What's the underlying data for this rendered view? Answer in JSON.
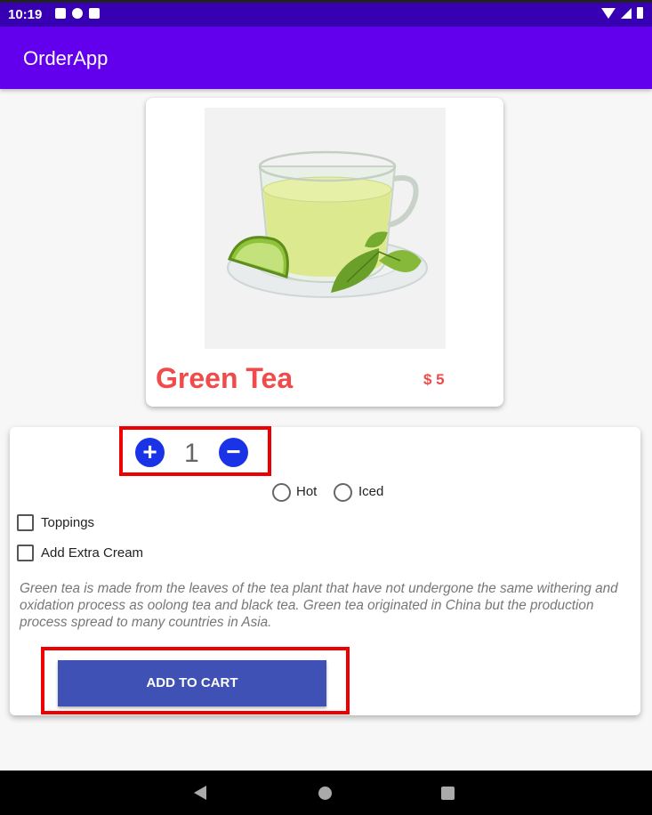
{
  "status_bar": {
    "time": "10:19",
    "left_icons": [
      "a-notification-icon",
      "settings-notification-icon",
      "sd-card-icon"
    ],
    "right_icons": [
      "wifi-icon",
      "signal-icon",
      "battery-icon"
    ]
  },
  "app_bar": {
    "title": "OrderApp",
    "color": "#6200ee"
  },
  "product": {
    "name": "Green Tea",
    "price": "$ 5",
    "image_icon": "green-tea-cup-image",
    "accent_color": "#f04a4a"
  },
  "quantity": {
    "plus": "+",
    "value": "1",
    "minus": "−"
  },
  "temperature": {
    "options": [
      {
        "label": "Hot"
      },
      {
        "label": "Iced"
      }
    ]
  },
  "extras": [
    {
      "label": "Toppings"
    },
    {
      "label": "Add Extra Cream"
    }
  ],
  "description": "Green tea is made from the leaves of the tea plant that have not undergone the same withering and oxidation process as oolong tea and black tea. Green tea originated in China but the production process spread to many countries in Asia.",
  "cart": {
    "label": "ADD TO CART",
    "color": "#3f51b5"
  },
  "nav_bar": {
    "icons": [
      "back-icon",
      "home-icon",
      "recents-icon"
    ]
  }
}
